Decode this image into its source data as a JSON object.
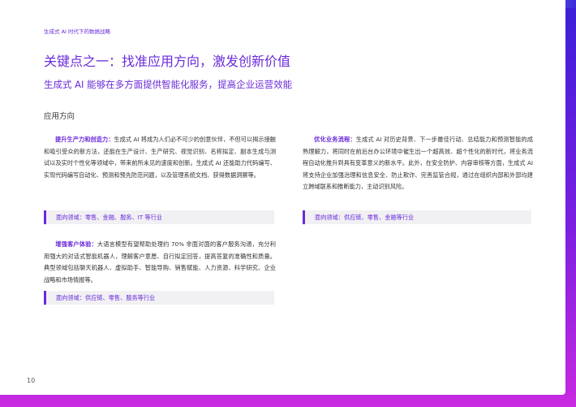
{
  "header": {
    "small_title": "生成式 AI 时代下的数据战略"
  },
  "main": {
    "title": "关键点之一：找准应用方向，激发创新价值",
    "subtitle": "生成式 AI 能够在多方面提供智能化服务，提高企业运营效能",
    "section_label": "应用方向"
  },
  "blocks": [
    {
      "lead": "提升生产力和创造力：",
      "body": "生成式 AI 将成为人们必不可少的创意伙伴，不但可以揭示接触和吸引受众的新方法，还能在生产设计、生产研究、视觉识别、名称拟定、副本生成与测试以及实时个性化等领域中，带来前所未见的速度和创新。生成式 AI 还能助力代码编写、实现代码编写自动化、预测和预先防范问题，以及管理系统文档、获得数据洞察等。",
      "tag": "面向领域：零售、金融、服务、IT 等行业"
    },
    {
      "lead": "优化业务流程：",
      "body": "生成式 AI 对历史背景、下一步最佳行动、总结能力和预测智能的成熟理解力，将同时在前后台办公环境中催生出一个超高效、超个性化的新时代，将业务流程自动化推升到具有变革意义的新水平。此外，在安全防护、内容审核等方面，生成式 AI 将支持企业加强治理和信息安全、防止欺诈、完善监管合规，通过在组织内部和外部均建立跨域联系和推断能力，主动识别风险。",
      "tag": "面向领域：供应链、零售、金融等行业"
    },
    {
      "lead": "增强客户体验：",
      "body": "大语言模型有望帮助处理约 70% 非面对面的客户服务沟通，充分利用强大的对话式智能机器人，理解客户意愿、自行拟定回答，提高答复的准确性和质量。典型领域包括聊天机器人、虚拟助手、智能导购、销售赋能、人力资源、科学研究、企业战略和市场情报等。",
      "tag": "面向领域：供应链、零售、服务等行业"
    }
  ],
  "footer": {
    "page_number": "10"
  }
}
